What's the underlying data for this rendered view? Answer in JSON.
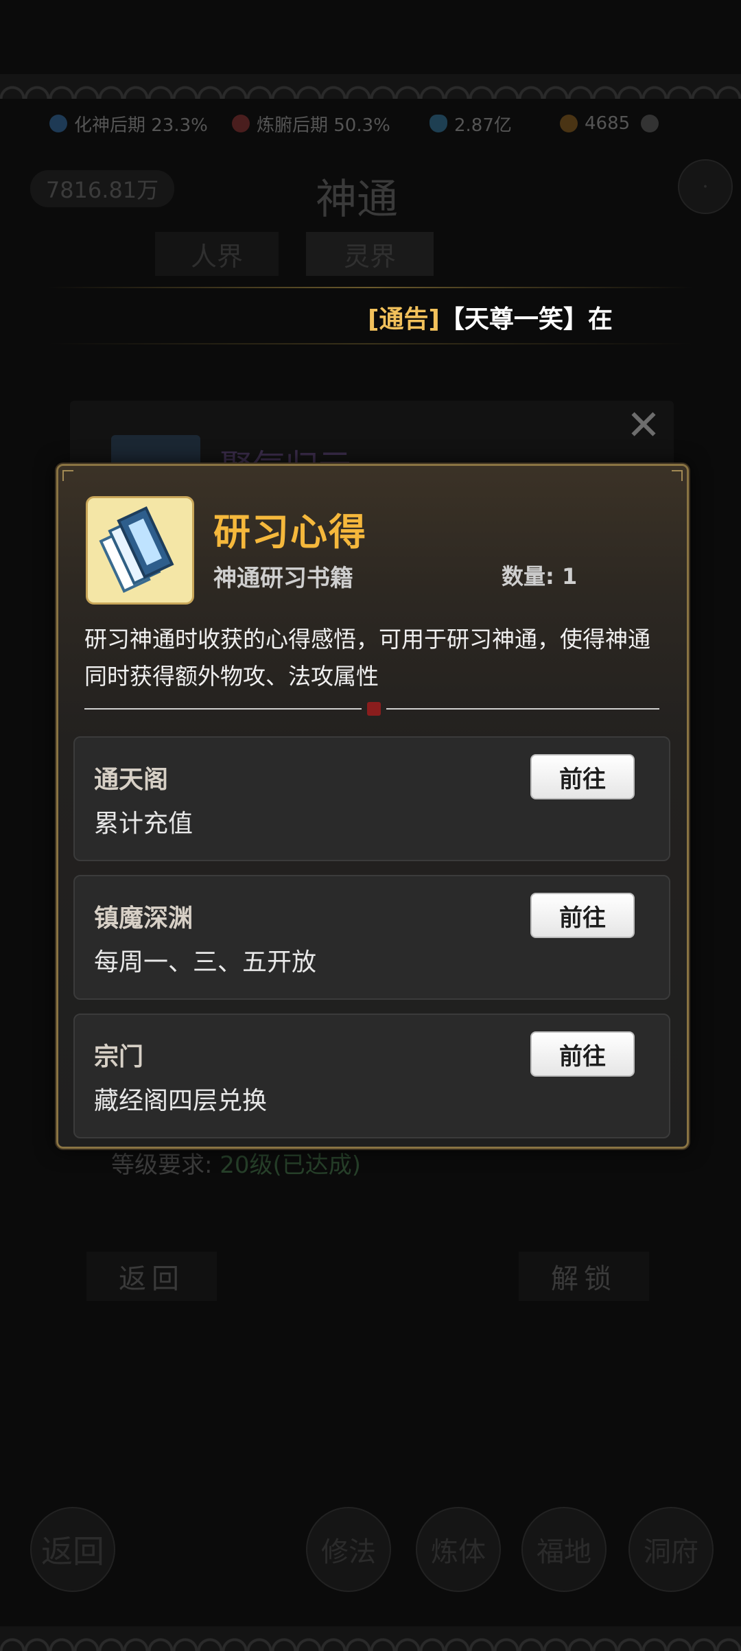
{
  "resources": [
    {
      "label": "化神后期 23.3%",
      "icon": "realm-icon"
    },
    {
      "label": "炼腑后期 50.3%",
      "icon": "body-realm-icon"
    },
    {
      "label": "2.87亿",
      "icon": "spirit-stone-icon"
    },
    {
      "label": "4685",
      "icon": "coin-icon"
    }
  ],
  "header": {
    "power": "7816.81万",
    "title": "神通",
    "tabs": [
      "人界",
      "灵界"
    ]
  },
  "announcement": {
    "tag": "[通告]",
    "message": "【天尊一笑】在"
  },
  "background_panel": {
    "skill_name": "聚气归元",
    "level_req_label": "等级要求:",
    "level_req_value": "20级(已达成)",
    "back_button": "返回",
    "unlock_button": "解锁"
  },
  "bottom_nav": [
    "返回",
    "修法",
    "炼体",
    "福地",
    "洞府"
  ],
  "item": {
    "name": "研习心得",
    "category": "神通研习书籍",
    "count_label": "数量: 1",
    "description": "研习神通时收获的心得感悟，可用于研习神通，使得神通同时获得额外物攻、法攻属性"
  },
  "sources": [
    {
      "name": "通天阁",
      "desc": "累计充值",
      "button": "前往"
    },
    {
      "name": "镇魔深渊",
      "desc": "每周一、三、五开放",
      "button": "前往"
    },
    {
      "name": "宗门",
      "desc": "藏经阁四层兑换",
      "button": "前往"
    }
  ],
  "colors": {
    "title_gold": "#f5b83c",
    "announce_tag": "#f2c15b",
    "modal_border": "#8a7443"
  }
}
